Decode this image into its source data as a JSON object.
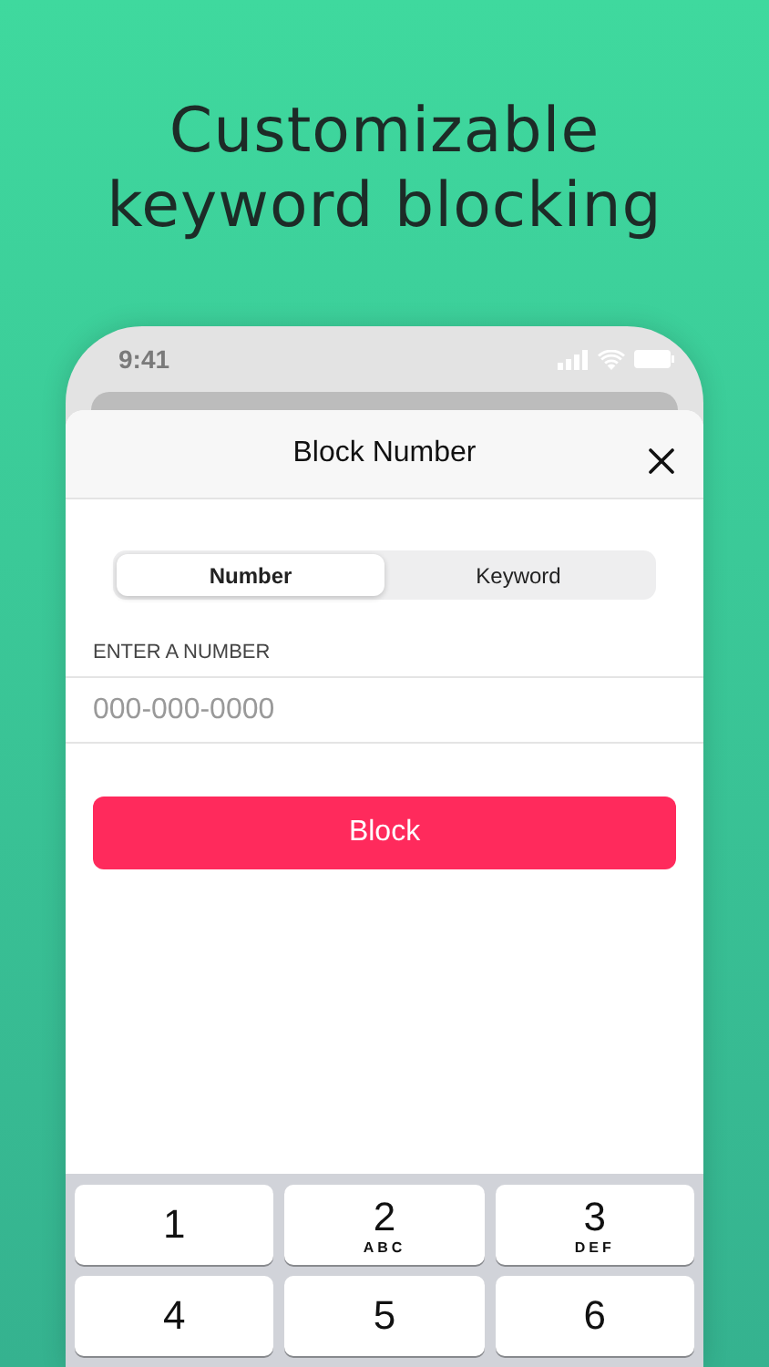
{
  "headline": [
    "Customizable",
    "keyword blocking"
  ],
  "status_bar": {
    "time": "9:41"
  },
  "sheet": {
    "title": "Block Number"
  },
  "segments": [
    {
      "label": "Number",
      "selected": true
    },
    {
      "label": "Keyword",
      "selected": false
    }
  ],
  "field": {
    "label": "ENTER A NUMBER",
    "placeholder": "000-000-0000"
  },
  "button": "Block",
  "keypad": [
    {
      "digit": "1"
    },
    {
      "digit": "2",
      "letters": "ABC"
    },
    {
      "digit": "3",
      "letters": "DEF"
    },
    {
      "digit": "4"
    },
    {
      "digit": "5"
    },
    {
      "digit": "6"
    }
  ]
}
